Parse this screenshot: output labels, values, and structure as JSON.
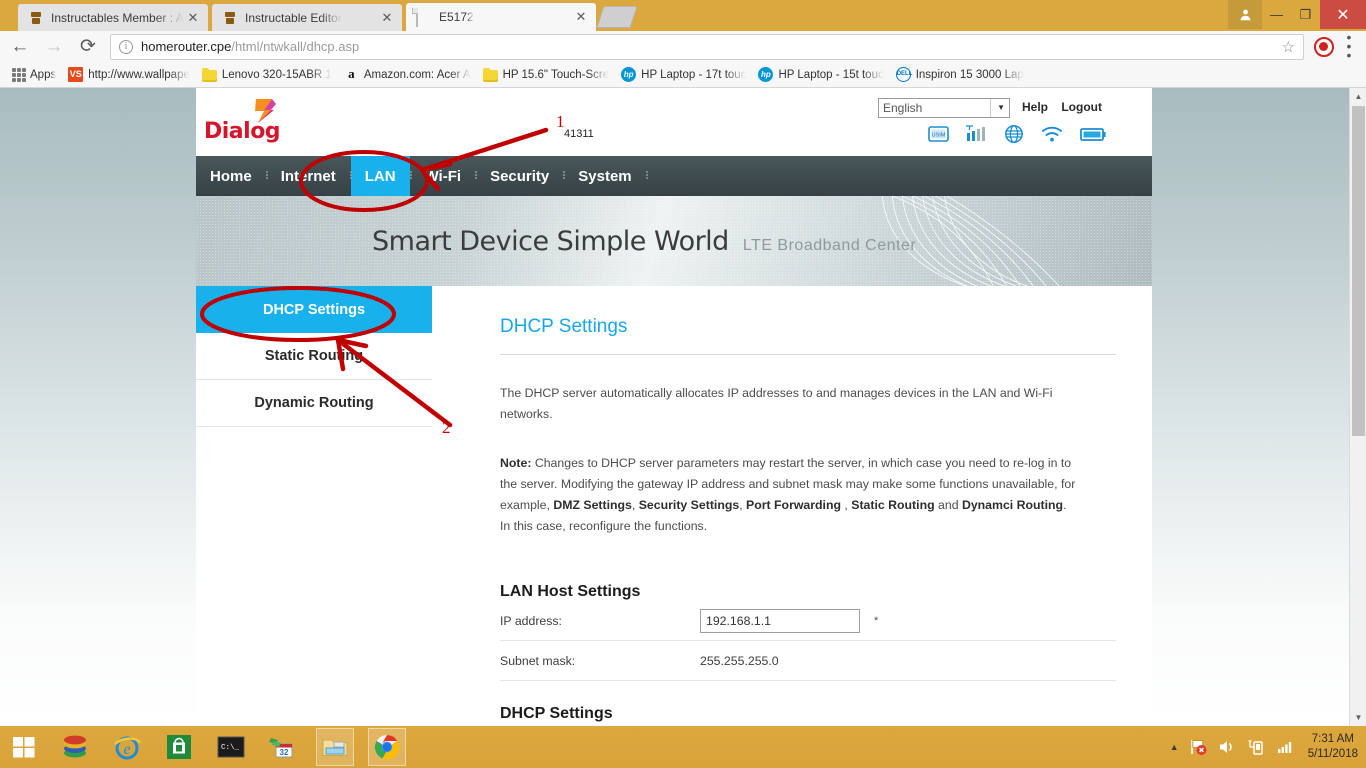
{
  "browser": {
    "tabs": [
      {
        "title": "Instructables Member : A",
        "favicon": "instructables-robot-icon",
        "active": false
      },
      {
        "title": "Instructable Editor",
        "favicon": "instructables-robot-icon",
        "active": false
      },
      {
        "title": "E5172",
        "favicon": "document-icon",
        "active": true
      }
    ],
    "new_tab_label": "",
    "nav": {
      "back": "←",
      "forward": "→",
      "reload": "⟳"
    },
    "omnibox": {
      "url_host": "homerouter.cpe",
      "url_path": "/html/ntwkall/dhcp.asp",
      "info_icon": "i",
      "star_icon": "☆"
    },
    "window_controls": {
      "user": "👤",
      "minimize": "—",
      "maximize": "❐",
      "close": "✕"
    },
    "bookmarks": {
      "apps_label": "Apps",
      "items": [
        {
          "label": "http://www.wallpape",
          "icon": "vs-icon"
        },
        {
          "label": "Lenovo 320-15ABR 1",
          "icon": "folder-icon"
        },
        {
          "label": "Amazon.com: Acer A",
          "icon": "amazon-icon"
        },
        {
          "label": "HP 15.6\" Touch-Scre",
          "icon": "folder-icon"
        },
        {
          "label": "HP Laptop - 17t touc",
          "icon": "hp-icon"
        },
        {
          "label": "HP Laptop - 15t touc",
          "icon": "hp-icon"
        },
        {
          "label": "Inspiron 15 3000 Lap",
          "icon": "dell-icon"
        }
      ]
    }
  },
  "router": {
    "brand": {
      "name": "Dialog",
      "logo": "dialog-logo"
    },
    "serial": "41311",
    "header": {
      "language": "English",
      "language_caret": "▼",
      "help": "Help",
      "logout": "Logout",
      "status_icons": [
        "usim-icon",
        "signal-bars-icon",
        "globe-icon",
        "wifi-icon",
        "battery-icon"
      ]
    },
    "nav": [
      {
        "label": "Home",
        "active": false
      },
      {
        "label": "Internet",
        "active": false
      },
      {
        "label": "LAN",
        "active": true
      },
      {
        "label": "Wi-Fi",
        "active": false
      },
      {
        "label": "Security",
        "active": false
      },
      {
        "label": "System",
        "active": false
      }
    ],
    "banner": {
      "headline": "Smart Device  Simple World",
      "subline": "LTE  Broadband  Center"
    },
    "sidebar": [
      {
        "label": "DHCP Settings",
        "active": true
      },
      {
        "label": "Static Routing",
        "active": false
      },
      {
        "label": "Dynamic Routing",
        "active": false
      }
    ],
    "main": {
      "title": "DHCP Settings",
      "intro": "The DHCP server automatically allocates IP addresses to and manages devices in the LAN and Wi-Fi networks.",
      "note_label": "Note:",
      "note_p1": " Changes to DHCP server parameters may restart the server, in which case you need to re-log in to the server. Modifying the gateway IP address and subnet mask may make some functions unavailable, for example, ",
      "note_b1": "DMZ Settings",
      "note_sep1": ", ",
      "note_b2": "Security Settings",
      "note_sep2": ", ",
      "note_b3": "Port Forwarding",
      "note_sep3": " , ",
      "note_b4": "Static Routing",
      "note_sep4": " and ",
      "note_b5": "Dynamci Routing",
      "note_p2": ". In this case, reconfigure the functions.",
      "lan_host_title": "LAN Host Settings",
      "fields": [
        {
          "label": "IP address:",
          "value": "192.168.1.1",
          "type": "input",
          "required_mark": "*"
        },
        {
          "label": "Subnet mask:",
          "value": "255.255.255.0",
          "type": "text",
          "required_mark": ""
        }
      ],
      "dhcp_section_title": "DHCP Settings"
    }
  },
  "annotations": [
    {
      "id": "1",
      "label": "1",
      "target": "nav-item-lan"
    },
    {
      "id": "2",
      "label": "2",
      "target": "sidebar-item-dhcp-settings"
    }
  ],
  "taskbar": {
    "start_label": "start-button",
    "items": [
      "winrar-icon",
      "internet-explorer-icon",
      "microsoft-store-icon",
      "command-prompt-icon",
      "calendar-icon",
      "file-explorer-icon",
      "google-chrome-icon"
    ],
    "tray": {
      "caret": "▲",
      "icons": [
        "flag-action-center-icon",
        "volume-icon",
        "usb-device-icon",
        "network-signal-icon"
      ],
      "time": "7:31 AM",
      "date": "5/11/2018"
    }
  },
  "colors": {
    "accent_blue": "#18b1ec",
    "nav_dark": "#3e4b4f",
    "brand_red": "#d6152b",
    "annotation_red": "#c00000",
    "taskbar": "#dca73d"
  }
}
